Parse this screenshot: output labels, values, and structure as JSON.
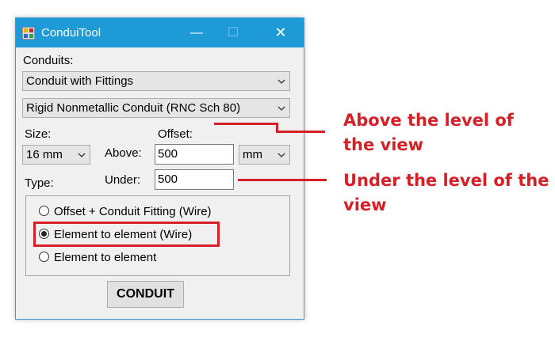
{
  "window": {
    "title": "ConduiTool",
    "minimize": "—",
    "maximize": "☐",
    "close": "✕"
  },
  "form": {
    "conduits_label": "Conduits:",
    "conduit_type_value": "Conduit with Fittings",
    "conduit_material_value": "Rigid Nonmetallic Conduit (RNC Sch 80)",
    "size_label": "Size:",
    "size_value": "16 mm",
    "offset_label": "Offset:",
    "above_label": "Above:",
    "above_value": "500",
    "under_label": "Under:",
    "under_value": "500",
    "unit_value": "mm",
    "type_label": "Type:",
    "radio_options": [
      {
        "label": "Offset + Conduit Fitting (Wire)",
        "checked": false
      },
      {
        "label": "Element to element (Wire)",
        "checked": true
      },
      {
        "label": "Element to element",
        "checked": false
      }
    ],
    "button_label": "CONDUIT"
  },
  "annotations": {
    "above_note": "Above the level of the view",
    "under_note": "Under the level of the view",
    "color": "#d52027"
  }
}
